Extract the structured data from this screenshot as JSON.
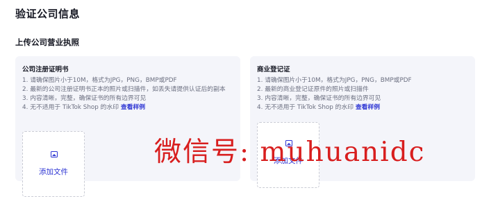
{
  "page": {
    "title": "验证公司信息",
    "section_title": "上传公司营业执照"
  },
  "cards": [
    {
      "title": "公司注册证明书",
      "requirements": [
        "1. 请确保图片小于10M，格式为JPG，PNG，BMP或PDF",
        "2. 最新的公司注册证明书正本的照片或扫描件，如丢失请提供认证后的副本",
        "3. 内容清晰，完整，确保证书的所有边界可见",
        "4. 无不适用于 TikTok Shop 的水印"
      ],
      "sample_link": "查看样例",
      "upload_label": "添加文件"
    },
    {
      "title": "商业登记证",
      "requirements": [
        "1. 请确保图片小于10M，格式为JPG，PNG，BMP或PDF",
        "2. 最新的商业登记证原件的照片或扫描件",
        "3. 内容清晰，完整，确保证书的所有边界可见",
        "4. 无不适用于 TikTok Shop 的水印"
      ],
      "sample_link": "查看样例",
      "upload_label": "添加文件"
    }
  ],
  "watermark": "微信号: muhuanidc",
  "colors": {
    "link": "#2c34d3",
    "card_bg": "#f4f5fa",
    "watermark": "#d81e1e"
  },
  "icons": {
    "upload": "image-icon"
  }
}
